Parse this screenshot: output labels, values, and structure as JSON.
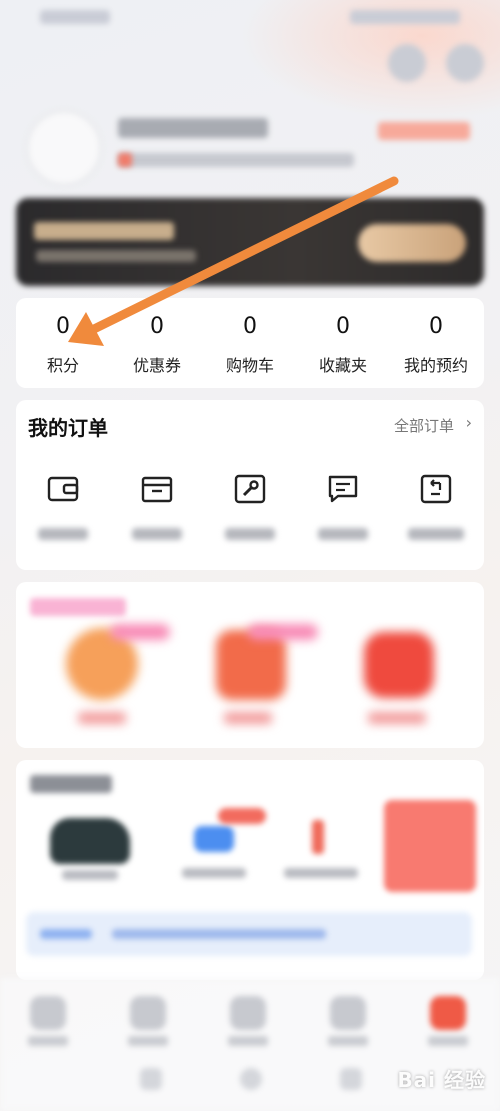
{
  "stats": [
    {
      "value": "0",
      "label": "积分"
    },
    {
      "value": "0",
      "label": "优惠券"
    },
    {
      "value": "0",
      "label": "购物车"
    },
    {
      "value": "0",
      "label": "收藏夹"
    },
    {
      "value": "0",
      "label": "我的预约"
    }
  ],
  "orders": {
    "title": "我的订单",
    "all_label": "全部订单",
    "chevron": "›",
    "items": [
      {
        "icon": "wallet-icon"
      },
      {
        "icon": "package-icon"
      },
      {
        "icon": "wrench-icon"
      },
      {
        "icon": "chat-icon"
      },
      {
        "icon": "return-icon"
      }
    ]
  },
  "annotation": {
    "color": "#f08a3c"
  },
  "watermark": {
    "text": "Bai 经验"
  }
}
